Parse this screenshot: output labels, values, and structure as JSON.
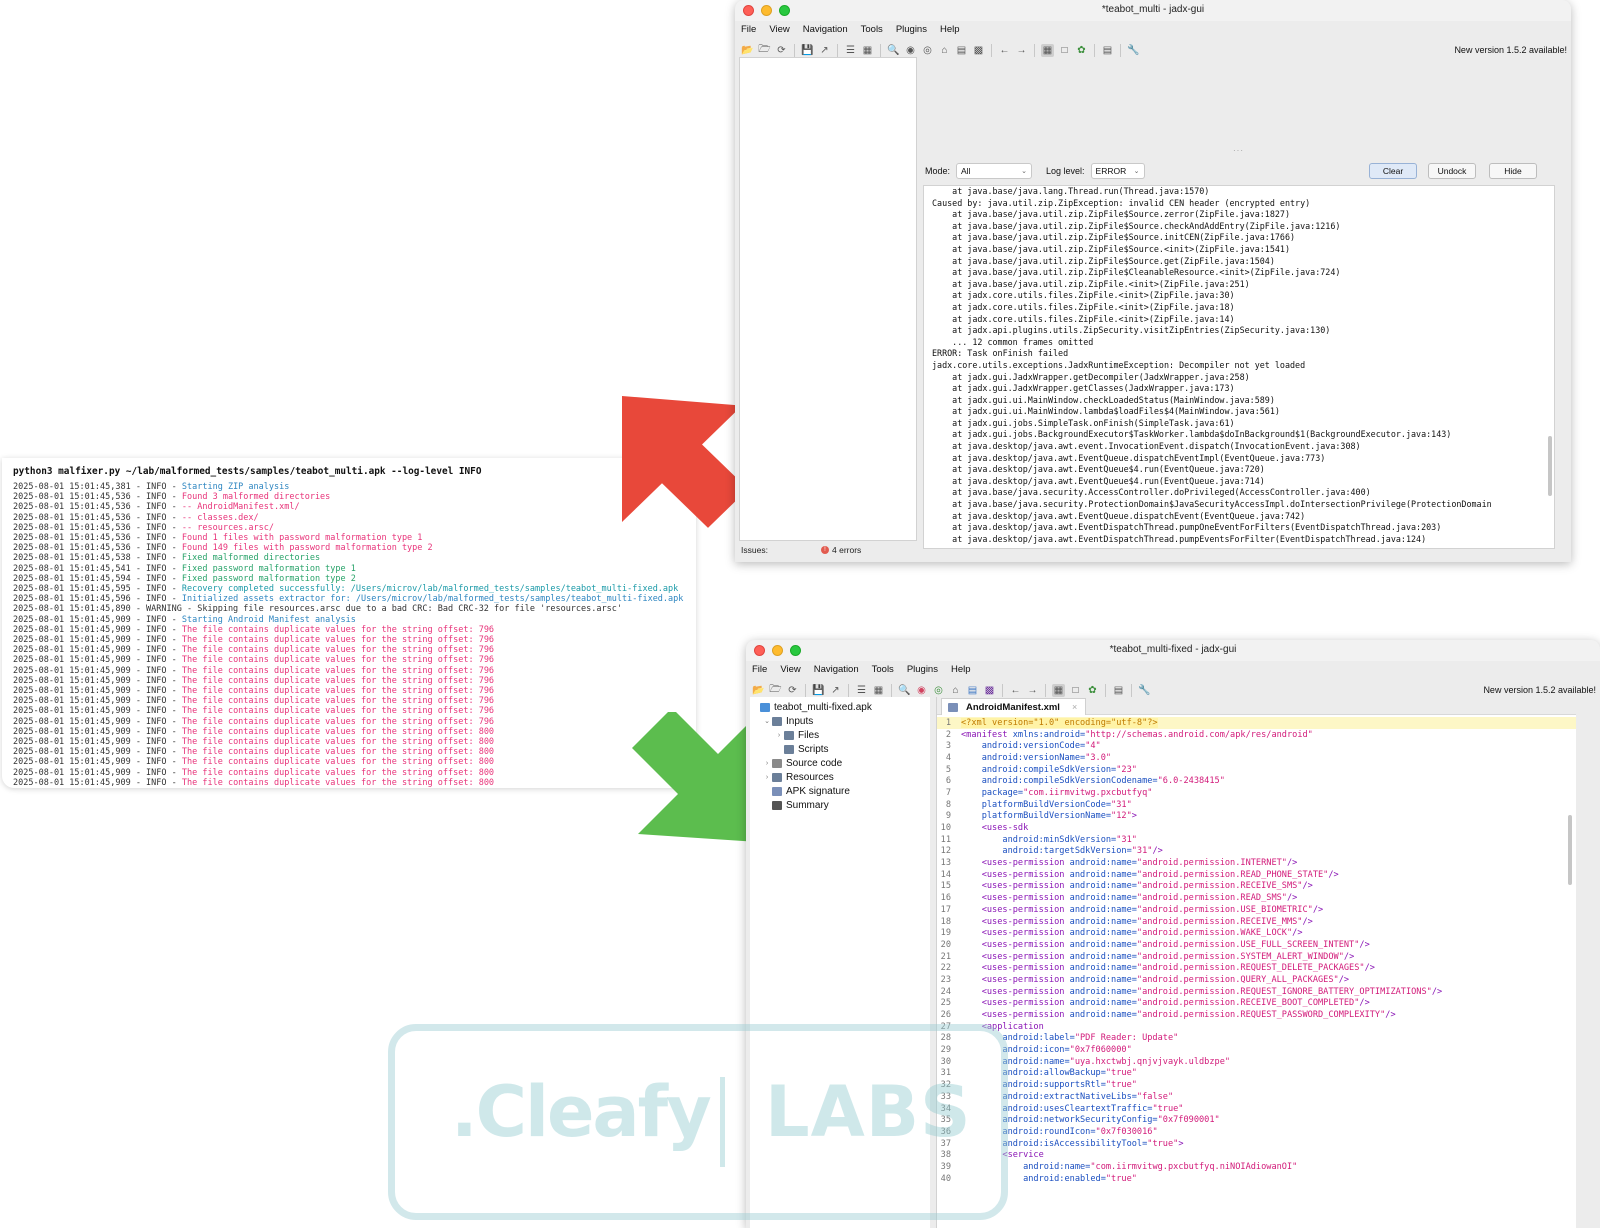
{
  "terminal": {
    "command": "python3 malfixer.py ~/lab/malformed_tests/samples/teabot_multi.apk --log-level INFO",
    "lines": [
      {
        "ts": "2025-08-01 15:01:45,381 - INFO - ",
        "msg": "Starting ZIP analysis",
        "color": "blue"
      },
      {
        "ts": "2025-08-01 15:01:45,536 - INFO - ",
        "msg": "Found 3 malformed directories",
        "color": "red"
      },
      {
        "ts": "2025-08-01 15:01:45,536 - INFO - ",
        "msg": "-- AndroidManifest.xml/",
        "color": "red"
      },
      {
        "ts": "2025-08-01 15:01:45,536 - INFO - ",
        "msg": "-- classes.dex/",
        "color": "red"
      },
      {
        "ts": "2025-08-01 15:01:45,536 - INFO - ",
        "msg": "-- resources.arsc/",
        "color": "red"
      },
      {
        "ts": "2025-08-01 15:01:45,536 - INFO - ",
        "msg": "Found 1 files with password malformation type 1",
        "color": "red"
      },
      {
        "ts": "2025-08-01 15:01:45,536 - INFO - ",
        "msg": "Found 149 files with password malformation type 2",
        "color": "red"
      },
      {
        "ts": "2025-08-01 15:01:45,538 - INFO - ",
        "msg": "Fixed malformed directories",
        "color": "green"
      },
      {
        "ts": "2025-08-01 15:01:45,541 - INFO - ",
        "msg": "Fixed password malformation type 1",
        "color": "green"
      },
      {
        "ts": "2025-08-01 15:01:45,594 - INFO - ",
        "msg": "Fixed password malformation type 2",
        "color": "green"
      },
      {
        "ts": "2025-08-01 15:01:45,595 - INFO - ",
        "msg": "Recovery completed successfully: /Users/microv/lab/malformed_tests/samples/teabot_multi-fixed.apk",
        "color": "cyan"
      },
      {
        "ts": "2025-08-01 15:01:45,596 - INFO - ",
        "msg": "Initialized assets extractor for: /Users/microv/lab/malformed_tests/samples/teabot_multi-fixed.apk",
        "color": "blue"
      },
      {
        "ts": "2025-08-01 15:01:45,890 - WARNING - ",
        "msg": "Skipping file resources.arsc due to a bad CRC: Bad CRC-32 for file 'resources.arsc'",
        "color": "black"
      },
      {
        "ts": "2025-08-01 15:01:45,909 - INFO - ",
        "msg": "Starting Android Manifest analysis",
        "color": "blue"
      },
      {
        "ts": "2025-08-01 15:01:45,909 - INFO - ",
        "msg": "The file contains duplicate values for the string offset: 796",
        "color": "red"
      },
      {
        "ts": "2025-08-01 15:01:45,909 - INFO - ",
        "msg": "The file contains duplicate values for the string offset: 796",
        "color": "red"
      },
      {
        "ts": "2025-08-01 15:01:45,909 - INFO - ",
        "msg": "The file contains duplicate values for the string offset: 796",
        "color": "red"
      },
      {
        "ts": "2025-08-01 15:01:45,909 - INFO - ",
        "msg": "The file contains duplicate values for the string offset: 796",
        "color": "red"
      },
      {
        "ts": "2025-08-01 15:01:45,909 - INFO - ",
        "msg": "The file contains duplicate values for the string offset: 796",
        "color": "red"
      },
      {
        "ts": "2025-08-01 15:01:45,909 - INFO - ",
        "msg": "The file contains duplicate values for the string offset: 796",
        "color": "red"
      },
      {
        "ts": "2025-08-01 15:01:45,909 - INFO - ",
        "msg": "The file contains duplicate values for the string offset: 796",
        "color": "red"
      },
      {
        "ts": "2025-08-01 15:01:45,909 - INFO - ",
        "msg": "The file contains duplicate values for the string offset: 796",
        "color": "red"
      },
      {
        "ts": "2025-08-01 15:01:45,909 - INFO - ",
        "msg": "The file contains duplicate values for the string offset: 796",
        "color": "red"
      },
      {
        "ts": "2025-08-01 15:01:45,909 - INFO - ",
        "msg": "The file contains duplicate values for the string offset: 796",
        "color": "red"
      },
      {
        "ts": "2025-08-01 15:01:45,909 - INFO - ",
        "msg": "The file contains duplicate values for the string offset: 800",
        "color": "red"
      },
      {
        "ts": "2025-08-01 15:01:45,909 - INFO - ",
        "msg": "The file contains duplicate values for the string offset: 800",
        "color": "red"
      },
      {
        "ts": "2025-08-01 15:01:45,909 - INFO - ",
        "msg": "The file contains duplicate values for the string offset: 800",
        "color": "red"
      },
      {
        "ts": "2025-08-01 15:01:45,909 - INFO - ",
        "msg": "The file contains duplicate values for the string offset: 800",
        "color": "red"
      },
      {
        "ts": "2025-08-01 15:01:45,909 - INFO - ",
        "msg": "The file contains duplicate values for the string offset: 800",
        "color": "red"
      },
      {
        "ts": "2025-08-01 15:01:45,909 - INFO - ",
        "msg": "The file contains duplicate values for the string offset: 800",
        "color": "red"
      }
    ]
  },
  "colors": {
    "red": "#e8347a",
    "green": "#29a36a",
    "blue": "#2e86c1",
    "cyan": "#1b9aa8",
    "black": "#333333",
    "arrow_red": "#e8483a",
    "arrow_green": "#5cbd4e"
  },
  "menu": [
    "File",
    "View",
    "Navigation",
    "Tools",
    "Plugins",
    "Help"
  ],
  "new_version": "New version 1.5.2 available!",
  "window_top": {
    "title": "*teabot_multi - jadx-gui",
    "mode_label": "Mode:",
    "mode_value": "All",
    "log_level_label": "Log level:",
    "log_level_value": "ERROR",
    "buttons": {
      "clear": "Clear",
      "undock": "Undock",
      "hide": "Hide"
    },
    "issues_label": "Issues:",
    "errors": "4 errors",
    "log_lines": [
      "    at java.base/java.lang.Thread.run(Thread.java:1570)",
      "Caused by: java.util.zip.ZipException: invalid CEN header (encrypted entry)",
      "    at java.base/java.util.zip.ZipFile$Source.zerror(ZipFile.java:1827)",
      "    at java.base/java.util.zip.ZipFile$Source.checkAndAddEntry(ZipFile.java:1216)",
      "    at java.base/java.util.zip.ZipFile$Source.initCEN(ZipFile.java:1766)",
      "    at java.base/java.util.zip.ZipFile$Source.<init>(ZipFile.java:1541)",
      "    at java.base/java.util.zip.ZipFile$Source.get(ZipFile.java:1504)",
      "    at java.base/java.util.zip.ZipFile$CleanableResource.<init>(ZipFile.java:724)",
      "    at java.base/java.util.zip.ZipFile.<init>(ZipFile.java:251)",
      "    at jadx.core.utils.files.ZipFile.<init>(ZipFile.java:30)",
      "    at jadx.core.utils.files.ZipFile.<init>(ZipFile.java:18)",
      "    at jadx.core.utils.files.ZipFile.<init>(ZipFile.java:14)",
      "    at jadx.api.plugins.utils.ZipSecurity.visitZipEntries(ZipSecurity.java:130)",
      "    ... 12 common frames omitted",
      "ERROR: Task onFinish failed",
      "jadx.core.utils.exceptions.JadxRuntimeException: Decompiler not yet loaded",
      "    at jadx.gui.JadxWrapper.getDecompiler(JadxWrapper.java:258)",
      "    at jadx.gui.JadxWrapper.getClasses(JadxWrapper.java:173)",
      "    at jadx.gui.ui.MainWindow.checkLoadedStatus(MainWindow.java:589)",
      "    at jadx.gui.ui.MainWindow.lambda$loadFiles$4(MainWindow.java:561)",
      "    at jadx.gui.jobs.SimpleTask.onFinish(SimpleTask.java:61)",
      "    at jadx.gui.jobs.BackgroundExecutor$TaskWorker.lambda$doInBackground$1(BackgroundExecutor.java:143)",
      "    at java.desktop/java.awt.event.InvocationEvent.dispatch(InvocationEvent.java:308)",
      "    at java.desktop/java.awt.EventQueue.dispatchEventImpl(EventQueue.java:773)",
      "    at java.desktop/java.awt.EventQueue$4.run(EventQueue.java:720)",
      "    at java.desktop/java.awt.EventQueue$4.run(EventQueue.java:714)",
      "    at java.base/java.security.AccessController.doPrivileged(AccessController.java:400)",
      "    at java.base/java.security.ProtectionDomain$JavaSecurityAccessImpl.doIntersectionPrivilege(ProtectionDomain",
      "    at java.desktop/java.awt.EventQueue.dispatchEvent(EventQueue.java:742)",
      "    at java.desktop/java.awt.EventDispatchThread.pumpOneEventForFilters(EventDispatchThread.java:203)",
      "    at java.desktop/java.awt.EventDispatchThread.pumpEventsForFilter(EventDispatchThread.java:124)"
    ]
  },
  "window_bottom": {
    "title": "*teabot_multi-fixed - jadx-gui",
    "tree": [
      {
        "label": "teabot_multi-fixed.apk",
        "depth": 0,
        "icon": "apk",
        "expander": ""
      },
      {
        "label": "Inputs",
        "depth": 1,
        "icon": "folder",
        "expander": "v"
      },
      {
        "label": "Files",
        "depth": 2,
        "icon": "folder",
        "expander": ">"
      },
      {
        "label": "Scripts",
        "depth": 2,
        "icon": "folder",
        "expander": ""
      },
      {
        "label": "Source code",
        "depth": 1,
        "icon": "package",
        "expander": ">"
      },
      {
        "label": "Resources",
        "depth": 1,
        "icon": "folder",
        "expander": ">"
      },
      {
        "label": "APK signature",
        "depth": 1,
        "icon": "cert",
        "expander": ""
      },
      {
        "label": "Summary",
        "depth": 1,
        "icon": "summary",
        "expander": ""
      }
    ],
    "tab_label": "AndroidManifest.xml",
    "code": [
      [
        {
          "t": "<?xml version=\"1.0\" encoding=\"utf-8\"?>",
          "c": "pi"
        }
      ],
      [
        {
          "t": "<manifest",
          "c": "tag"
        },
        {
          "t": " xmlns:android=",
          "c": "attr"
        },
        {
          "t": "\"http://schemas.android.com/apk/res/android\"",
          "c": "val"
        }
      ],
      [
        {
          "t": "    android:versionCode=",
          "c": "attr"
        },
        {
          "t": "\"4\"",
          "c": "val"
        }
      ],
      [
        {
          "t": "    android:versionName=",
          "c": "attr"
        },
        {
          "t": "\"3.0\"",
          "c": "val"
        }
      ],
      [
        {
          "t": "    android:compileSdkVersion=",
          "c": "attr"
        },
        {
          "t": "\"23\"",
          "c": "val"
        }
      ],
      [
        {
          "t": "    android:compileSdkVersionCodename=",
          "c": "attr"
        },
        {
          "t": "\"6.0-2438415\"",
          "c": "val"
        }
      ],
      [
        {
          "t": "    package=",
          "c": "attr"
        },
        {
          "t": "\"com.iirmvitwg.pxcbutfyq\"",
          "c": "val"
        }
      ],
      [
        {
          "t": "    platformBuildVersionCode=",
          "c": "attr"
        },
        {
          "t": "\"31\"",
          "c": "val"
        }
      ],
      [
        {
          "t": "    platformBuildVersionName=",
          "c": "attr"
        },
        {
          "t": "\"12\"",
          "c": "val"
        },
        {
          "t": ">",
          "c": "tag"
        }
      ],
      [
        {
          "t": "    <uses-sdk",
          "c": "tag"
        }
      ],
      [
        {
          "t": "        android:minSdkVersion=",
          "c": "attr"
        },
        {
          "t": "\"31\"",
          "c": "val"
        }
      ],
      [
        {
          "t": "        android:targetSdkVersion=",
          "c": "attr"
        },
        {
          "t": "\"31\"",
          "c": "val"
        },
        {
          "t": "/>",
          "c": "tag"
        }
      ],
      [
        {
          "t": "    <uses-permission",
          "c": "tag"
        },
        {
          "t": " android:name=",
          "c": "attr"
        },
        {
          "t": "\"android.permission.INTERNET\"",
          "c": "val"
        },
        {
          "t": "/>",
          "c": "tag"
        }
      ],
      [
        {
          "t": "    <uses-permission",
          "c": "tag"
        },
        {
          "t": " android:name=",
          "c": "attr"
        },
        {
          "t": "\"android.permission.READ_PHONE_STATE\"",
          "c": "val"
        },
        {
          "t": "/>",
          "c": "tag"
        }
      ],
      [
        {
          "t": "    <uses-permission",
          "c": "tag"
        },
        {
          "t": " android:name=",
          "c": "attr"
        },
        {
          "t": "\"android.permission.RECEIVE_SMS\"",
          "c": "val"
        },
        {
          "t": "/>",
          "c": "tag"
        }
      ],
      [
        {
          "t": "    <uses-permission",
          "c": "tag"
        },
        {
          "t": " android:name=",
          "c": "attr"
        },
        {
          "t": "\"android.permission.READ_SMS\"",
          "c": "val"
        },
        {
          "t": "/>",
          "c": "tag"
        }
      ],
      [
        {
          "t": "    <uses-permission",
          "c": "tag"
        },
        {
          "t": " android:name=",
          "c": "attr"
        },
        {
          "t": "\"android.permission.USE_BIOMETRIC\"",
          "c": "val"
        },
        {
          "t": "/>",
          "c": "tag"
        }
      ],
      [
        {
          "t": "    <uses-permission",
          "c": "tag"
        },
        {
          "t": " android:name=",
          "c": "attr"
        },
        {
          "t": "\"android.permission.RECEIVE_MMS\"",
          "c": "val"
        },
        {
          "t": "/>",
          "c": "tag"
        }
      ],
      [
        {
          "t": "    <uses-permission",
          "c": "tag"
        },
        {
          "t": " android:name=",
          "c": "attr"
        },
        {
          "t": "\"android.permission.WAKE_LOCK\"",
          "c": "val"
        },
        {
          "t": "/>",
          "c": "tag"
        }
      ],
      [
        {
          "t": "    <uses-permission",
          "c": "tag"
        },
        {
          "t": " android:name=",
          "c": "attr"
        },
        {
          "t": "\"android.permission.USE_FULL_SCREEN_INTENT\"",
          "c": "val"
        },
        {
          "t": "/>",
          "c": "tag"
        }
      ],
      [
        {
          "t": "    <uses-permission",
          "c": "tag"
        },
        {
          "t": " android:name=",
          "c": "attr"
        },
        {
          "t": "\"android.permission.SYSTEM_ALERT_WINDOW\"",
          "c": "val"
        },
        {
          "t": "/>",
          "c": "tag"
        }
      ],
      [
        {
          "t": "    <uses-permission",
          "c": "tag"
        },
        {
          "t": " android:name=",
          "c": "attr"
        },
        {
          "t": "\"android.permission.REQUEST_DELETE_PACKAGES\"",
          "c": "val"
        },
        {
          "t": "/>",
          "c": "tag"
        }
      ],
      [
        {
          "t": "    <uses-permission",
          "c": "tag"
        },
        {
          "t": " android:name=",
          "c": "attr"
        },
        {
          "t": "\"android.permission.QUERY_ALL_PACKAGES\"",
          "c": "val"
        },
        {
          "t": "/>",
          "c": "tag"
        }
      ],
      [
        {
          "t": "    <uses-permission",
          "c": "tag"
        },
        {
          "t": " android:name=",
          "c": "attr"
        },
        {
          "t": "\"android.permission.REQUEST_IGNORE_BATTERY_OPTIMIZATIONS\"",
          "c": "val"
        },
        {
          "t": "/>",
          "c": "tag"
        }
      ],
      [
        {
          "t": "    <uses-permission",
          "c": "tag"
        },
        {
          "t": " android:name=",
          "c": "attr"
        },
        {
          "t": "\"android.permission.RECEIVE_BOOT_COMPLETED\"",
          "c": "val"
        },
        {
          "t": "/>",
          "c": "tag"
        }
      ],
      [
        {
          "t": "    <uses-permission",
          "c": "tag"
        },
        {
          "t": " android:name=",
          "c": "attr"
        },
        {
          "t": "\"android.permission.REQUEST_PASSWORD_COMPLEXITY\"",
          "c": "val"
        },
        {
          "t": "/>",
          "c": "tag"
        }
      ],
      [
        {
          "t": "    <application",
          "c": "tag"
        }
      ],
      [
        {
          "t": "        android:label=",
          "c": "attr"
        },
        {
          "t": "\"PDF Reader: Update\"",
          "c": "val"
        }
      ],
      [
        {
          "t": "        android:icon=",
          "c": "attr"
        },
        {
          "t": "\"0x7f060000\"",
          "c": "val"
        }
      ],
      [
        {
          "t": "        android:name=",
          "c": "attr"
        },
        {
          "t": "\"uya.hxctwbj.qnjvjvayk.uldbzpe\"",
          "c": "val"
        }
      ],
      [
        {
          "t": "        android:allowBackup=",
          "c": "attr"
        },
        {
          "t": "\"true\"",
          "c": "val"
        }
      ],
      [
        {
          "t": "        android:supportsRtl=",
          "c": "attr"
        },
        {
          "t": "\"true\"",
          "c": "val"
        }
      ],
      [
        {
          "t": "        android:extractNativeLibs=",
          "c": "attr"
        },
        {
          "t": "\"false\"",
          "c": "val"
        }
      ],
      [
        {
          "t": "        android:usesCleartextTraffic=",
          "c": "attr"
        },
        {
          "t": "\"true\"",
          "c": "val"
        }
      ],
      [
        {
          "t": "        android:networkSecurityConfig=",
          "c": "attr"
        },
        {
          "t": "\"0x7f090001\"",
          "c": "val"
        }
      ],
      [
        {
          "t": "        android:roundIcon=",
          "c": "attr"
        },
        {
          "t": "\"0x7f030016\"",
          "c": "val"
        }
      ],
      [
        {
          "t": "        android:isAccessibilityTool=",
          "c": "attr"
        },
        {
          "t": "\"true\"",
          "c": "val"
        },
        {
          "t": ">",
          "c": "tag"
        }
      ],
      [
        {
          "t": "        <service",
          "c": "tag"
        }
      ],
      [
        {
          "t": "            android:name=",
          "c": "attr"
        },
        {
          "t": "\"com.iirmvitwg.pxcbutfyq.niNOIAdiowanOI\"",
          "c": "val"
        }
      ],
      [
        {
          "t": "            android:enabled=",
          "c": "attr"
        },
        {
          "t": "\"true\"",
          "c": "val"
        }
      ]
    ]
  },
  "watermark": {
    "left": ".Cleafy",
    "right": "LABS"
  }
}
